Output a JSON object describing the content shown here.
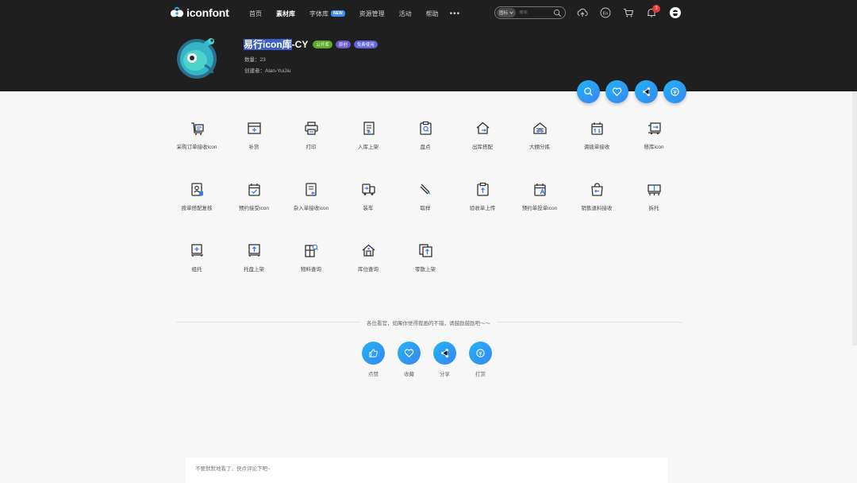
{
  "brand": {
    "name": "iconfont"
  },
  "nav": {
    "items": [
      {
        "label": "首页"
      },
      {
        "label": "素材库",
        "active": true
      },
      {
        "label": "字体库",
        "badge": "NEW"
      },
      {
        "label": "资源管理"
      },
      {
        "label": "活动"
      },
      {
        "label": "帮助"
      }
    ],
    "more": "•••"
  },
  "search": {
    "category": "图标",
    "placeholder": "搜索"
  },
  "topbar": {
    "notification_count": "3",
    "language": "En"
  },
  "library": {
    "title_highlight": "易行icon库",
    "title_rest": "-CY",
    "tags": [
      "公开库",
      "原创",
      "免费使用"
    ],
    "count_label": "数量：",
    "count": "23",
    "creator_label": "创建者：",
    "creator": "Alan-YuiJiu"
  },
  "icons": [
    {
      "label": "采购订单接收icon",
      "icon": "cart-list"
    },
    {
      "label": "补货",
      "icon": "box-plus"
    },
    {
      "label": "打印",
      "icon": "printer"
    },
    {
      "label": "入库上架",
      "icon": "doc-arrow-in"
    },
    {
      "label": "盘点",
      "icon": "clipboard-search"
    },
    {
      "label": "出库搭配",
      "icon": "home-arrow-out"
    },
    {
      "label": "大棚分拣",
      "icon": "greenhouse"
    },
    {
      "label": "调拨单接收",
      "icon": "calendar-transfer"
    },
    {
      "label": "移库icon",
      "icon": "truck-transfer"
    },
    {
      "label": "按单搭配复核",
      "icon": "doc-user"
    },
    {
      "label": "预约接受icon",
      "icon": "calendar-check"
    },
    {
      "label": "杂入单接收icon",
      "icon": "doc-arrow-left"
    },
    {
      "label": "装车",
      "icon": "truck-load"
    },
    {
      "label": "取样",
      "icon": "tweezers"
    },
    {
      "label": "验收单上传",
      "icon": "clipboard-upload"
    },
    {
      "label": "预约单投单icon",
      "icon": "calendar-a"
    },
    {
      "label": "销售退料接收",
      "icon": "bag-return"
    },
    {
      "label": "拆托",
      "icon": "pallet-split"
    },
    {
      "label": "组托",
      "icon": "pallet-plus"
    },
    {
      "label": "托盘上架",
      "icon": "pallet-up"
    },
    {
      "label": "物料查询",
      "icon": "material-search"
    },
    {
      "label": "库位查询",
      "icon": "location-search"
    },
    {
      "label": "零散上架",
      "icon": "scatter-up"
    }
  ],
  "footer": {
    "encourage": "各位看官，如果你觉得我画的不错，请鼓励鼓励吧～～",
    "actions": [
      {
        "label": "点赞",
        "icon": "thumb-up"
      },
      {
        "label": "收藏",
        "icon": "heart"
      },
      {
        "label": "分享",
        "icon": "share"
      },
      {
        "label": "打赏",
        "icon": "reward"
      }
    ],
    "comment_placeholder": "不要默默地看了，快点评论下吧~"
  },
  "colors": {
    "accent_start": "#1fb3f5",
    "accent_end": "#3a86f2",
    "header_bg": "#1f1f1f",
    "icon_stroke": "#333333",
    "icon_accent": "#3a7bf2"
  }
}
